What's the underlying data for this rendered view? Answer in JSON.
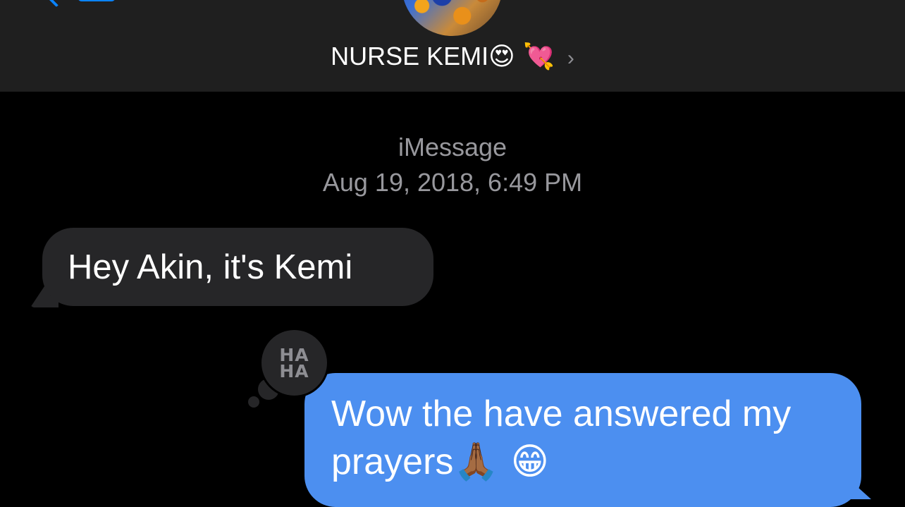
{
  "header": {
    "contact_name": "NURSE KEMI",
    "contact_emoji": "😍 💘",
    "chevron": "›"
  },
  "thread": {
    "service": "iMessage",
    "timestamp": "Aug 19, 2018, 6:49 PM"
  },
  "messages": [
    {
      "direction": "incoming",
      "text": "Hey Akin, it's Kemi"
    },
    {
      "direction": "outgoing",
      "text": "Wow the have answered my prayers",
      "emoji": "🙏🏾 😁",
      "tapback": [
        "HA",
        "HA"
      ]
    }
  ],
  "colors": {
    "outgoing_bubble": "#4c8ff0",
    "incoming_bubble": "#262628",
    "header_bg": "#1f1f1f",
    "accent": "#0a84ff"
  }
}
